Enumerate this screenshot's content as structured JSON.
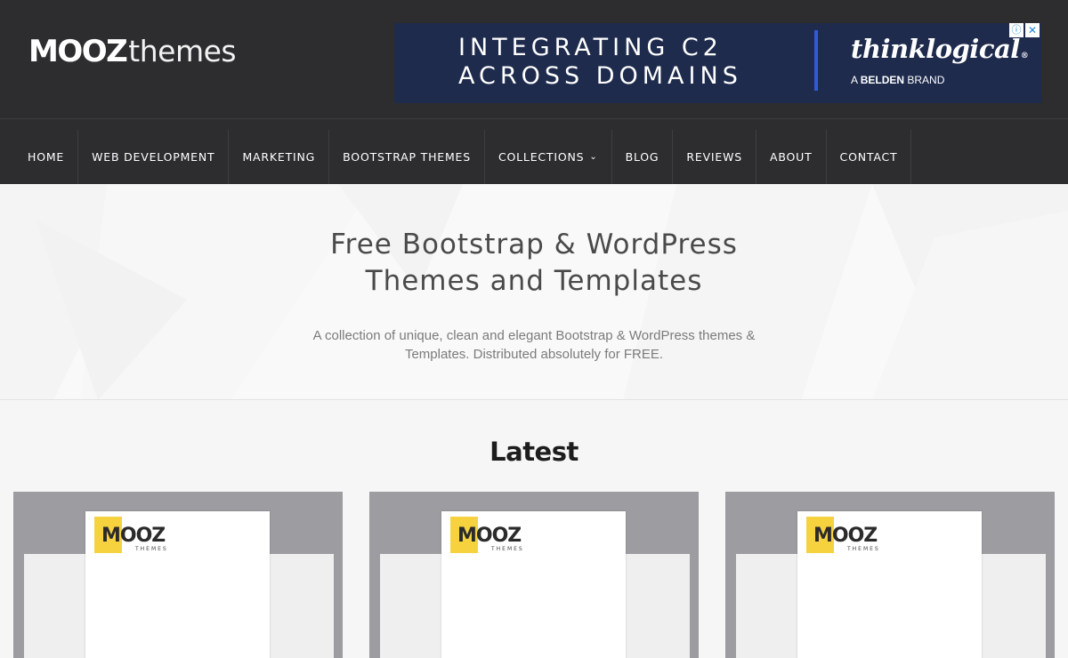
{
  "site": {
    "logo_bold": "MOOZ",
    "logo_light": "themes"
  },
  "ad": {
    "headline": "INTEGRATING C2 ACROSS DOMAINS",
    "brand": "thinklogical",
    "brand_mark": "®",
    "sub_prefix": "A",
    "sub_bold": "BELDEN",
    "sub_suffix": "BRAND",
    "info_icon": "ⓘ",
    "close_icon": "✕",
    "colors": {
      "background": "#1e2b4d",
      "divider": "#2f5bd8"
    }
  },
  "nav": {
    "items": [
      {
        "label": "HOME"
      },
      {
        "label": "WEB DEVELOPMENT"
      },
      {
        "label": "MARKETING"
      },
      {
        "label": "BOOTSTRAP THEMES"
      },
      {
        "label": "COLLECTIONS",
        "has_dropdown": true,
        "chevron": "⌄"
      },
      {
        "label": "BLOG"
      },
      {
        "label": "REVIEWS"
      },
      {
        "label": "ABOUT"
      },
      {
        "label": "CONTACT"
      }
    ]
  },
  "hero": {
    "title_line1": "Free Bootstrap & WordPress",
    "title_line2": "Themes and Templates",
    "description": "A collection of unique, clean and elegant Bootstrap & WordPress themes & Templates. Distributed absolutely for FREE."
  },
  "latest": {
    "title": "Latest",
    "cards": [
      {
        "logo_word": "MOOZ",
        "logo_sub": "THEMES"
      },
      {
        "logo_word": "MOOZ",
        "logo_sub": "THEMES"
      },
      {
        "logo_word": "MOOZ",
        "logo_sub": "THEMES"
      }
    ]
  },
  "colors": {
    "header_bg": "#2d2d2f",
    "accent_yellow": "#f7d23f",
    "card_bg": "#9c9ca1"
  }
}
